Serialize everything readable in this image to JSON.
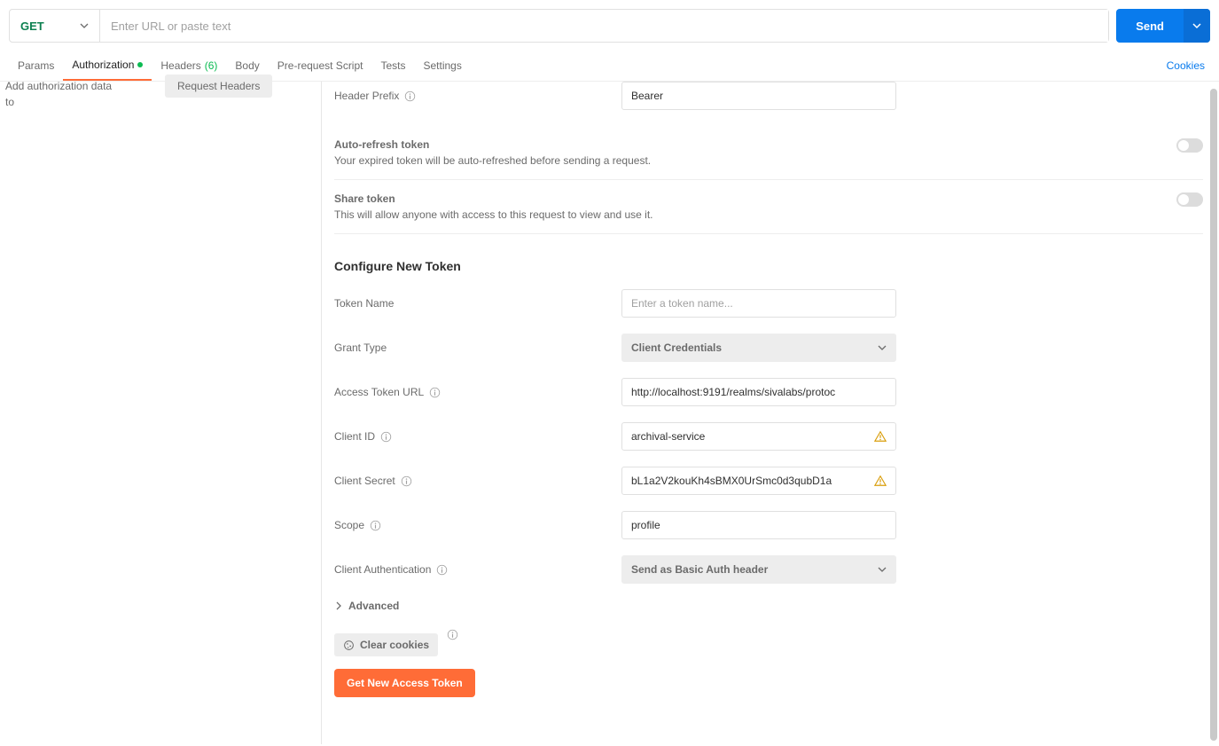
{
  "request": {
    "method": "GET",
    "url_placeholder": "Enter URL or paste text",
    "send_label": "Send"
  },
  "tabs": {
    "params": "Params",
    "authorization": "Authorization",
    "headers": "Headers",
    "headers_count": "(6)",
    "body": "Body",
    "prerequest": "Pre-request Script",
    "tests": "Tests",
    "settings": "Settings",
    "cookies": "Cookies"
  },
  "left": {
    "truncated_line1": "Add authorization data",
    "truncated_line2": "to",
    "pill": "Request Headers"
  },
  "form": {
    "header_prefix_label": "Header Prefix",
    "header_prefix_value": "Bearer",
    "auto_refresh_title": "Auto-refresh token",
    "auto_refresh_desc": "Your expired token will be auto-refreshed before sending a request.",
    "share_token_title": "Share token",
    "share_token_desc": "This will allow anyone with access to this request to view and use it.",
    "configure_title": "Configure New Token",
    "token_name_label": "Token Name",
    "token_name_placeholder": "Enter a token name...",
    "grant_type_label": "Grant Type",
    "grant_type_value": "Client Credentials",
    "access_token_url_label": "Access Token URL",
    "access_token_url_value": "http://localhost:9191/realms/sivalabs/protoc",
    "client_id_label": "Client ID",
    "client_id_value": "archival-service",
    "client_secret_label": "Client Secret",
    "client_secret_value": "bL1a2V2kouKh4sBMX0UrSmc0d3qubD1a",
    "scope_label": "Scope",
    "scope_value": "profile",
    "client_auth_label": "Client Authentication",
    "client_auth_value": "Send as Basic Auth header",
    "advanced_label": "Advanced",
    "clear_cookies_label": "Clear cookies",
    "get_token_label": "Get New Access Token"
  }
}
